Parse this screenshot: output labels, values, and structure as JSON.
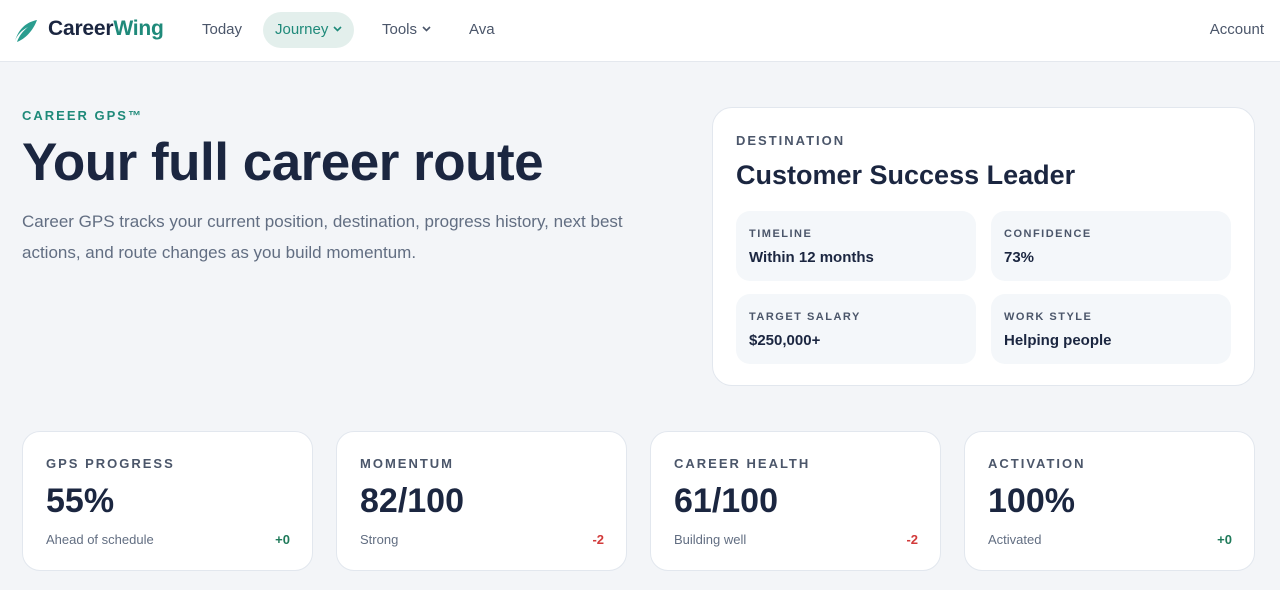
{
  "nav": {
    "brand_main": "Career",
    "brand_accent": "Wing",
    "items": [
      {
        "label": "Today"
      },
      {
        "label": "Journey"
      },
      {
        "label": "Tools"
      },
      {
        "label": "Ava"
      }
    ],
    "active_item": "Journey",
    "account": "Account"
  },
  "hero": {
    "eyebrow": "CAREER GPS™",
    "title": "Your full career route",
    "description": "Career GPS tracks your current position, destination, progress history, next best actions, and route changes as you build momentum."
  },
  "destination": {
    "label": "DESTINATION",
    "title": "Customer Success Leader",
    "tiles": [
      {
        "label": "TIMELINE",
        "value": "Within 12 months"
      },
      {
        "label": "CONFIDENCE",
        "value": "73%"
      },
      {
        "label": "TARGET SALARY",
        "value": "$250,000+"
      },
      {
        "label": "WORK STYLE",
        "value": "Helping people"
      }
    ]
  },
  "stats": [
    {
      "label": "GPS PROGRESS",
      "value": "55%",
      "sub": "Ahead of schedule",
      "delta": "+0"
    },
    {
      "label": "MOMENTUM",
      "value": "82/100",
      "sub": "Strong",
      "delta": "-2"
    },
    {
      "label": "CAREER HEALTH",
      "value": "61/100",
      "sub": "Building well",
      "delta": "-2"
    },
    {
      "label": "ACTIVATION",
      "value": "100%",
      "sub": "Activated",
      "delta": "+0"
    }
  ],
  "colors": {
    "accent": "#1f8a7a",
    "text_dark": "#1b2640",
    "delta_positive": "#1f7a5a",
    "delta_negative": "#d23a3a",
    "background": "#f3f5f8"
  },
  "icons": {
    "logo": "feather-logo-icon",
    "dropdown": "chevron-down-icon"
  }
}
